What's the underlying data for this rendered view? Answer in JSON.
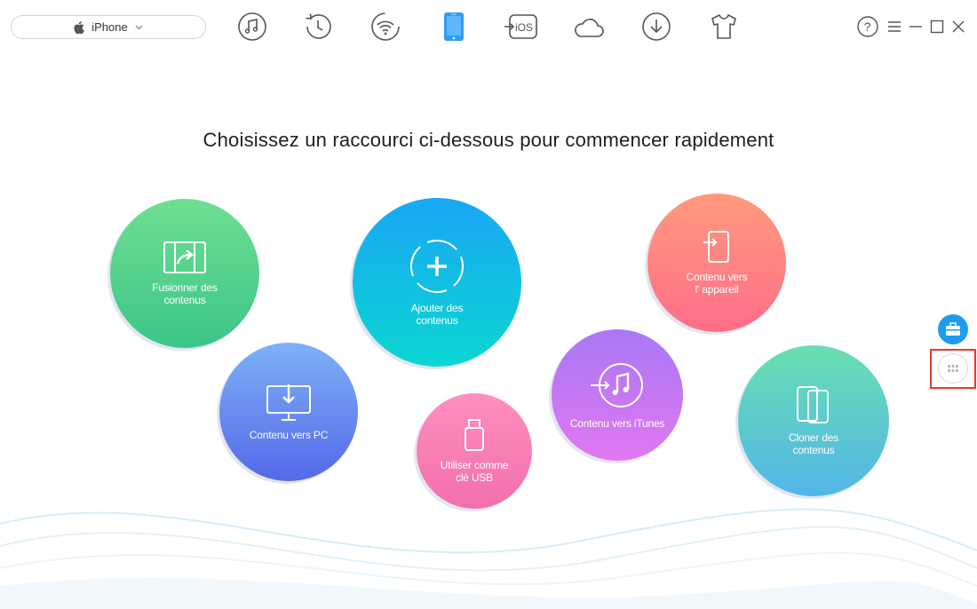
{
  "device": {
    "name": "iPhone"
  },
  "toolbar": {
    "items": [
      {
        "name": "music",
        "icon": "music-note-icon"
      },
      {
        "name": "history",
        "icon": "history-clock-icon"
      },
      {
        "name": "wifi",
        "icon": "wifi-icon"
      },
      {
        "name": "device",
        "icon": "phone-icon",
        "active": true
      },
      {
        "name": "ios",
        "icon": "ios-mover-icon",
        "label": "iOS"
      },
      {
        "name": "cloud",
        "icon": "cloud-icon"
      },
      {
        "name": "download",
        "icon": "download-icon"
      },
      {
        "name": "toolkit",
        "icon": "tshirt-icon"
      }
    ]
  },
  "window": {
    "help": "?"
  },
  "heading": "Choisissez un raccourci ci-dessous pour commencer rapidement",
  "shortcuts": {
    "merge": {
      "line1": "Fusionner des",
      "line2": "contenus"
    },
    "add": {
      "line1": "Ajouter des",
      "line2": "contenus"
    },
    "to_device": {
      "line1": "Contenu vers",
      "line2": "l' appareil"
    },
    "to_pc": {
      "line1": "Contenu vers PC"
    },
    "usb": {
      "line1": "Utiliser comme",
      "line2": "clé USB"
    },
    "to_itunes": {
      "line1": "Contenu vers iTunes"
    },
    "clone": {
      "line1": "Cloner des",
      "line2": "contenus"
    }
  },
  "colors": {
    "accent": "#1e9cf0",
    "highlight": "#e8392c",
    "merge": "#4fd18d",
    "add": "#10b9e6",
    "to_device": "#ff8282",
    "to_pc": "#6a8ef2",
    "usb": "#f77db6",
    "to_itunes": "#c078f2",
    "clone": "#5cc8cc"
  }
}
